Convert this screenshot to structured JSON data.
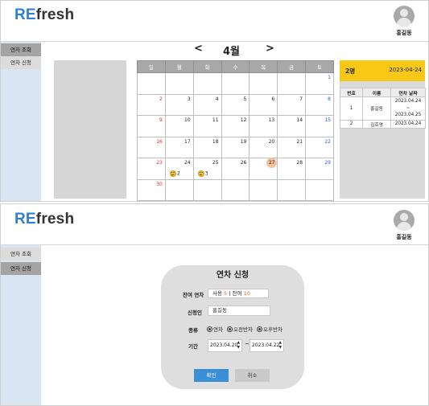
{
  "app": {
    "brand_prefix": "RE",
    "brand_suffix": "fresh"
  },
  "user": {
    "name": "홍길동"
  },
  "sidebar": {
    "items": [
      {
        "label": "연차 조회"
      },
      {
        "label": "연차 신청"
      }
    ]
  },
  "calendar": {
    "prev": "<",
    "month": "4월",
    "next": ">",
    "weekdays": [
      "일",
      "월",
      "화",
      "수",
      "목",
      "금",
      "토"
    ],
    "weeks": [
      [
        "",
        "",
        "",
        "",
        "",
        "",
        "1"
      ],
      [
        "2",
        "3",
        "4",
        "5",
        "6",
        "7",
        "8"
      ],
      [
        "9",
        "10",
        "11",
        "12",
        "13",
        "14",
        "15"
      ],
      [
        "16",
        "17",
        "18",
        "19",
        "20",
        "21",
        "22"
      ],
      [
        "23",
        "24",
        "25",
        "26",
        "27",
        "28",
        "29"
      ],
      [
        "30",
        "",
        "",
        "",
        "",
        "",
        ""
      ]
    ],
    "highlight_day": "27",
    "leave_counts": {
      "day24": "2",
      "day25": "3"
    }
  },
  "day_panel": {
    "count": "2명",
    "date": "2023-04-24",
    "columns": [
      "번호",
      "이름",
      "연차 날짜"
    ],
    "rows": [
      {
        "no": "1",
        "name": "홍길동",
        "from": "2023.04.24",
        "sep": "~",
        "to": "2023.04.25"
      },
      {
        "no": "2",
        "name": "김호영",
        "from": "2023.04.24"
      }
    ]
  },
  "request_form": {
    "title": "연차 신청",
    "remaining_label": "잔여 연차",
    "used_label": "사용",
    "used_value": "5",
    "divider": "|",
    "remaining_text": "잔여",
    "remaining_value": "10",
    "applicant_label": "신청인",
    "applicant_value": "홍길동",
    "type_label": "종류",
    "type_options": [
      "연차",
      "오전반차",
      "오후반차"
    ],
    "period_label": "기간",
    "start_date": "2023.04.20",
    "tilde": "~",
    "end_date": "2023.04.22",
    "ok_label": "확인",
    "cancel_label": "취소"
  },
  "colors": {
    "brand_blue": "#2f7fd6",
    "sidebar_bg": "#d9e6f2",
    "panel_yellow": "#f7c815",
    "ok_blue": "#3a8ed6",
    "sunday_red": "#e0282f",
    "saturday_blue": "#2d5fc8",
    "highlight_orange": "#f5c2a0"
  },
  "icons": {
    "avatar": "user-avatar-icon",
    "leave_marker": "smiley-icon",
    "spinner": "spinner-arrows-icon"
  }
}
